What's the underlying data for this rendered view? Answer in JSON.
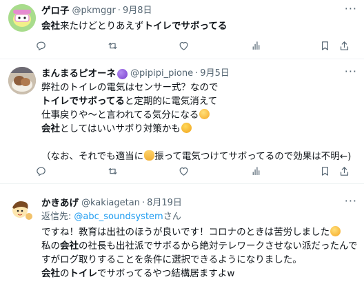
{
  "tweets": [
    {
      "name": "ゲロ子",
      "handle": "@pkmggr",
      "date": "9月8日",
      "lines": [
        [
          {
            "t": "会社",
            "b": true
          },
          {
            "t": "来たけどとりあえず"
          },
          {
            "t": "トイレでサボってる",
            "b": true
          }
        ]
      ]
    },
    {
      "name": "まんまるピオーネ",
      "handle": "@pipipi_pione",
      "date": "9月5日",
      "lines": [
        [
          {
            "t": "弊社のトイレの電気はセンサー式？なので"
          }
        ],
        [
          {
            "t": "トイレでサボってる",
            "b": true
          },
          {
            "t": "と定期的に電気消えて"
          }
        ],
        [
          {
            "t": "仕事戻りや～と言われてる気分になる"
          }
        ],
        [
          {
            "t": "会社",
            "b": true
          },
          {
            "t": "としてはいいサボり対策かも"
          }
        ],
        [
          {
            "t": ""
          }
        ],
        [
          {
            "t": "（なお、それでも適当に"
          },
          {
            "t": "振って電気つけてサボってるので効果は不明←)"
          }
        ]
      ]
    },
    {
      "name": "かきあげ",
      "handle": "@kakiagetan",
      "date": "8月19日",
      "reply_label": "返信先:",
      "reply_handle": "@abc_soundsystem",
      "reply_suffix": "さん",
      "lines": [
        [
          {
            "t": "ですね！教育は出社のほうが良いです！コロナのときは苦労しました"
          }
        ],
        [
          {
            "t": "私の"
          },
          {
            "t": "会社",
            "b": true
          },
          {
            "t": "の社長も出社派でサボるから絶対テレワークさせない派だったんで"
          }
        ],
        [
          {
            "t": "すがログ取りすることを条件に選択できるようになりました。"
          }
        ],
        [
          {
            "t": "会社",
            "b": true
          },
          {
            "t": "の"
          },
          {
            "t": "トイレ",
            "b": true
          },
          {
            "t": "でサボってるやつ結構居ますよw"
          }
        ]
      ]
    }
  ],
  "icons": {
    "more": "more-dots-icon",
    "reply": "reply-icon",
    "retweet": "retweet-icon",
    "like": "heart-icon",
    "views": "views-icon",
    "bookmark": "bookmark-icon",
    "share": "share-icon"
  },
  "colors": {
    "text": "#0f1419",
    "secondary": "#536471",
    "link": "#1d9bf0",
    "divider": "#eff3f4"
  }
}
